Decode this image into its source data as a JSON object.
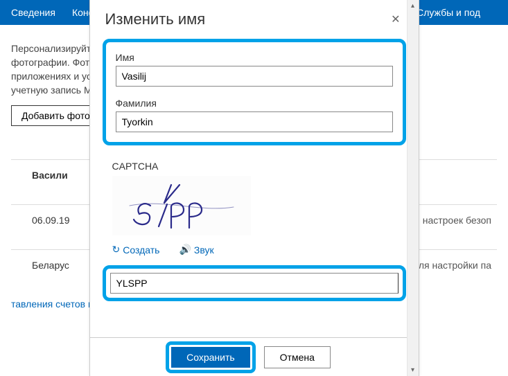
{
  "topbar": {
    "tab1": "Сведения",
    "tab2": "Конф",
    "right": "Службы и под"
  },
  "page": {
    "desc_l1": "Персонализируйте св",
    "desc_l2": "фотографии. Фотогра",
    "desc_l3": "приложениях и устро",
    "desc_l4": "учетную запись Майк",
    "add_photo": "Добавить фотогра",
    "row_name": "Васили",
    "row_date": "06.09.19",
    "row_country": "Беларус",
    "row_date_right": "ля настроек безоп",
    "row_country_right": "для настройки па",
    "bottom_link": "тавления счетов и до"
  },
  "modal": {
    "title": "Изменить имя",
    "first_label": "Имя",
    "first_value": "Vasilij",
    "last_label": "Фамилия",
    "last_value": "Tyorkin",
    "captcha_label": "CAPTCHA",
    "regen": "Создать",
    "audio": "Звук",
    "captcha_value": "YLSPP",
    "save": "Сохранить",
    "cancel": "Отмена"
  }
}
